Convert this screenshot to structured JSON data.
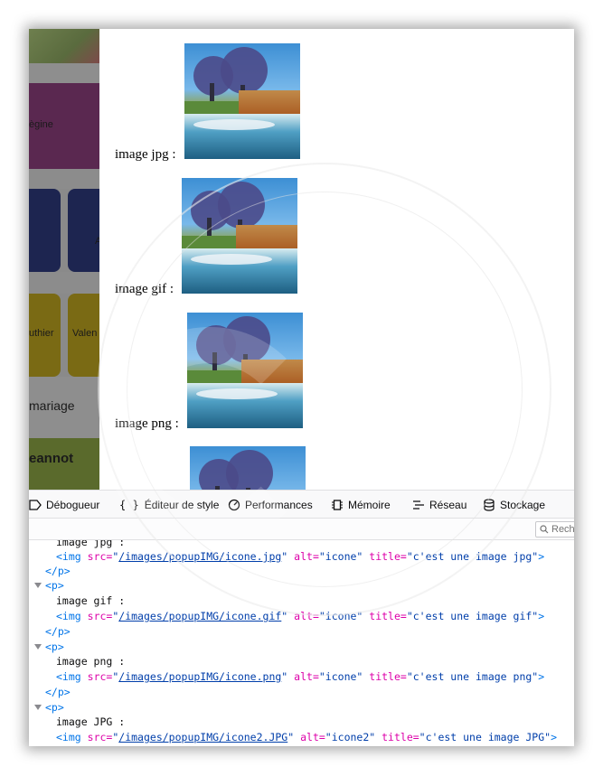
{
  "background_page": {
    "texts": [
      "ègine",
      "A",
      "uthier",
      "Valen",
      "mariage",
      "eannot"
    ]
  },
  "content": {
    "rows": [
      {
        "label": "image jpg :"
      },
      {
        "label": "image gif :"
      },
      {
        "label": "image png :"
      }
    ]
  },
  "devtools": {
    "tabs": [
      {
        "label": "Débogueur",
        "icon": "debugger-icon"
      },
      {
        "label": "Éditeur de style",
        "icon": "braces-icon"
      },
      {
        "label": "Performances",
        "icon": "performance-gauge-icon"
      },
      {
        "label": "Mémoire",
        "icon": "memory-chip-icon"
      },
      {
        "label": "Réseau",
        "icon": "network-icon"
      },
      {
        "label": "Stockage",
        "icon": "storage-database-icon"
      }
    ],
    "search_placeholder": "Rech",
    "code": {
      "l0_text": "image jpg :",
      "img1": {
        "tag": "<img",
        "src_attr": "src=",
        "src": "/images/popupIMG/icone.jpg",
        "alt_attr": "alt=",
        "alt": "\"icone\"",
        "title_attr": "title=",
        "title": "\"c'est une image jpg\"",
        "close": ">"
      },
      "p_close": "</p>",
      "p_open": "<p>",
      "t2": "image gif :",
      "img2": {
        "src": "/images/popupIMG/icone.gif",
        "alt": "\"icone\"",
        "title": "\"c'est une image gif\""
      },
      "t3": "image png :",
      "img3": {
        "src": "/images/popupIMG/icone.png",
        "alt": "\"icone\"",
        "title": "\"c'est une image png\""
      },
      "t4": "image JPG :",
      "img4": {
        "src": "/images/popupIMG/icone2.JPG",
        "alt": "\"icone2\"",
        "title": "\"c'est une image JPG\""
      }
    }
  }
}
